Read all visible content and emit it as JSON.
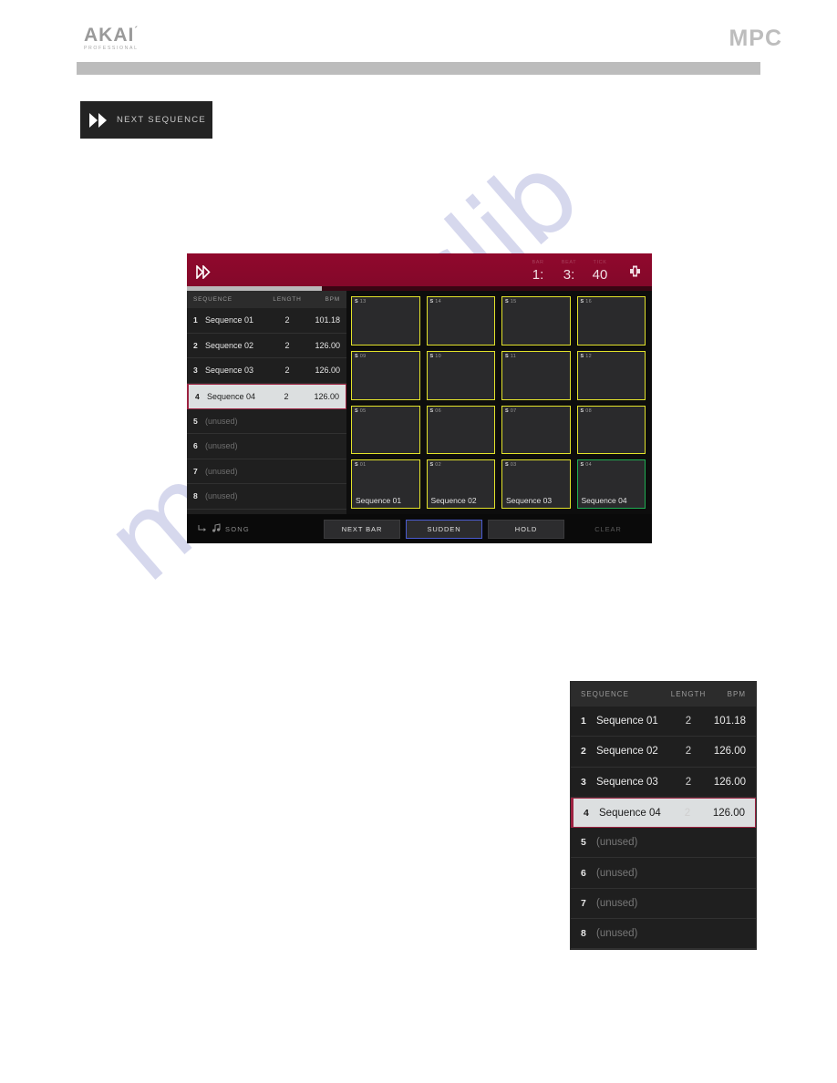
{
  "page": {
    "watermark": "manualslib",
    "brand_left": {
      "name": "AKAI",
      "tagline": "PROFESSIONAL"
    },
    "brand_right": "MPC"
  },
  "callout_button": {
    "icon": "double-chevron-right-icon",
    "label": "NEXT SEQUENCE"
  },
  "screen": {
    "header": {
      "play_icon": "double-chevron-right-icon",
      "transport": [
        {
          "label": "BAR",
          "value": "1:"
        },
        {
          "label": "BEAT",
          "value": "3:"
        },
        {
          "label": "TICK",
          "value": "40"
        }
      ],
      "metronome_icon": "metronome-icon",
      "progress_percent": 29
    },
    "sequence_table": {
      "columns": {
        "name": "SEQUENCE",
        "length": "LENGTH",
        "bpm": "BPM"
      },
      "rows": [
        {
          "num": "1",
          "name": "Sequence 01",
          "length": "2",
          "bpm": "101.18",
          "state": "normal"
        },
        {
          "num": "2",
          "name": "Sequence 02",
          "length": "2",
          "bpm": "126.00",
          "state": "normal"
        },
        {
          "num": "3",
          "name": "Sequence 03",
          "length": "2",
          "bpm": "126.00",
          "state": "normal"
        },
        {
          "num": "4",
          "name": "Sequence 04",
          "length": "2",
          "bpm": "126.00",
          "state": "selected"
        },
        {
          "num": "5",
          "name": "(unused)",
          "length": "",
          "bpm": "",
          "state": "unused"
        },
        {
          "num": "6",
          "name": "(unused)",
          "length": "",
          "bpm": "",
          "state": "unused"
        },
        {
          "num": "7",
          "name": "(unused)",
          "length": "",
          "bpm": "",
          "state": "unused"
        },
        {
          "num": "8",
          "name": "(unused)",
          "length": "",
          "bpm": "",
          "state": "unused"
        }
      ]
    },
    "pads": [
      {
        "id": "13",
        "prefix": "S",
        "name": "",
        "color": "yellow"
      },
      {
        "id": "14",
        "prefix": "S",
        "name": "",
        "color": "yellow"
      },
      {
        "id": "15",
        "prefix": "S",
        "name": "",
        "color": "yellow"
      },
      {
        "id": "16",
        "prefix": "S",
        "name": "",
        "color": "yellow"
      },
      {
        "id": "09",
        "prefix": "S",
        "name": "",
        "color": "yellow"
      },
      {
        "id": "10",
        "prefix": "S",
        "name": "",
        "color": "yellow"
      },
      {
        "id": "11",
        "prefix": "S",
        "name": "",
        "color": "yellow"
      },
      {
        "id": "12",
        "prefix": "S",
        "name": "",
        "color": "yellow"
      },
      {
        "id": "05",
        "prefix": "S",
        "name": "",
        "color": "yellow"
      },
      {
        "id": "06",
        "prefix": "S",
        "name": "",
        "color": "yellow"
      },
      {
        "id": "07",
        "prefix": "S",
        "name": "",
        "color": "yellow"
      },
      {
        "id": "08",
        "prefix": "S",
        "name": "",
        "color": "yellow"
      },
      {
        "id": "01",
        "prefix": "S",
        "name": "Sequence 01",
        "color": "yellow"
      },
      {
        "id": "02",
        "prefix": "S",
        "name": "Sequence 02",
        "color": "yellow"
      },
      {
        "id": "03",
        "prefix": "S",
        "name": "Sequence 03",
        "color": "yellow"
      },
      {
        "id": "04",
        "prefix": "S",
        "name": "Sequence 04",
        "color": "green"
      }
    ],
    "footer": {
      "song_icon": "arrow-turn-right-icon",
      "note_icon": "music-note-icon",
      "song_label": "SONG",
      "buttons": [
        {
          "label": "NEXT BAR",
          "style": "normal"
        },
        {
          "label": "SUDDEN",
          "style": "accent"
        },
        {
          "label": "HOLD",
          "style": "normal"
        },
        {
          "label": "CLEAR",
          "style": "disabled"
        }
      ]
    }
  },
  "detail_panel": {
    "columns": {
      "name": "SEQUENCE",
      "length": "LENGTH",
      "bpm": "BPM"
    },
    "rows": [
      {
        "num": "1",
        "name": "Sequence 01",
        "length": "2",
        "bpm": "101.18",
        "state": "normal"
      },
      {
        "num": "2",
        "name": "Sequence 02",
        "length": "2",
        "bpm": "126.00",
        "state": "normal"
      },
      {
        "num": "3",
        "name": "Sequence 03",
        "length": "2",
        "bpm": "126.00",
        "state": "normal"
      },
      {
        "num": "4",
        "name": "Sequence 04",
        "length": "2",
        "bpm": "126.00",
        "state": "selected"
      },
      {
        "num": "5",
        "name": "(unused)",
        "length": "",
        "bpm": "",
        "state": "unused"
      },
      {
        "num": "6",
        "name": "(unused)",
        "length": "",
        "bpm": "",
        "state": "unused"
      },
      {
        "num": "7",
        "name": "(unused)",
        "length": "",
        "bpm": "",
        "state": "unused"
      },
      {
        "num": "8",
        "name": "(unused)",
        "length": "",
        "bpm": "",
        "state": "unused"
      }
    ]
  },
  "colors": {
    "accent_red": "#8c0a2d",
    "pad_yellow": "#e3e32a",
    "pad_green": "#1eae52",
    "selected_outline": "#9d2241",
    "watermark": "#c9cbe8"
  }
}
